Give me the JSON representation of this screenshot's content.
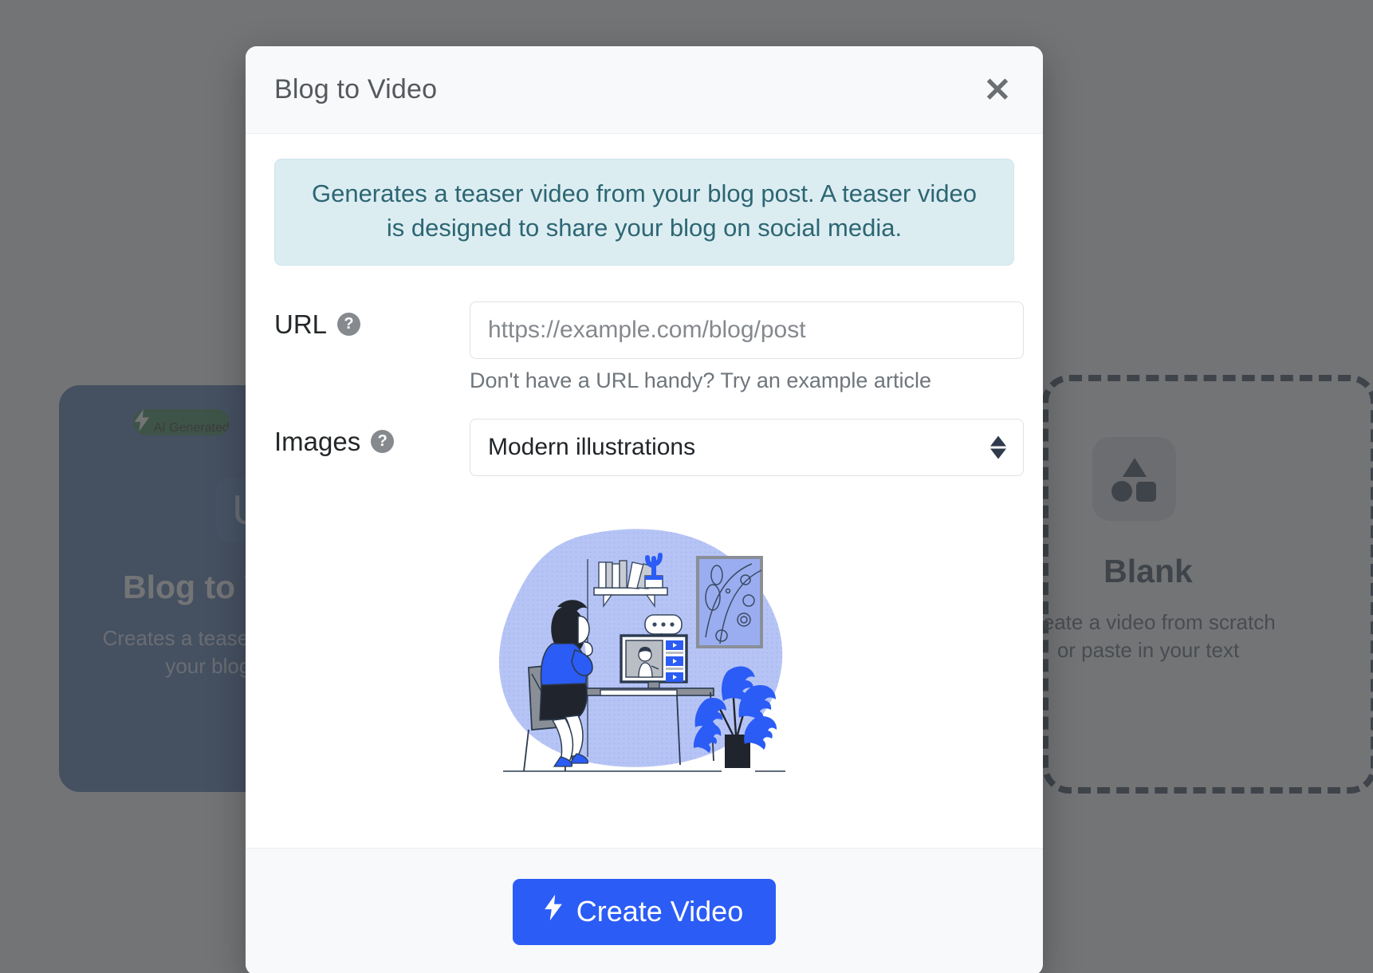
{
  "background": {
    "cards": [
      {
        "id": "blog-to-video",
        "badge": "AI Generated",
        "badge_icon": "lightning-bolt-icon",
        "title": "Blog to Video",
        "description": "Creates a teaser video from\nyour blog post",
        "bg_color": "#2e5d9f",
        "badge_color": "#146c2e"
      },
      {
        "id": "blank",
        "icon": "shapes-icon",
        "title": "Blank",
        "description": "Create a video from scratch\nor paste in your text",
        "border_color": "#16263c"
      }
    ]
  },
  "modal": {
    "title": "Blog to Video",
    "close_label": "✕",
    "info_banner": "Generates a teaser video from your blog post. A teaser video is designed to share your blog on social media.",
    "fields": [
      {
        "label": "URL",
        "help_icon": "question-mark-icon",
        "type": "text",
        "value": "",
        "placeholder": "https://example.com/blog/post",
        "hint": "Don't have a URL handy? Try an example article"
      },
      {
        "label": "Images",
        "help_icon": "question-mark-icon",
        "type": "select",
        "value": "Modern illustrations",
        "options": [
          "Modern illustrations"
        ]
      }
    ],
    "preview_illustration": "woman-watching-video-at-desk-illustration",
    "footer": {
      "submit_label": "Create Video",
      "submit_icon": "lightning-bolt-icon",
      "submit_color": "#2b5cf6"
    }
  },
  "colors": {
    "overlay": "#4c4d50",
    "header_bg": "#f8f9fa",
    "banner_bg": "#dcedf2",
    "banner_text": "#2d6673",
    "accent_blue": "#2b5cf6"
  }
}
